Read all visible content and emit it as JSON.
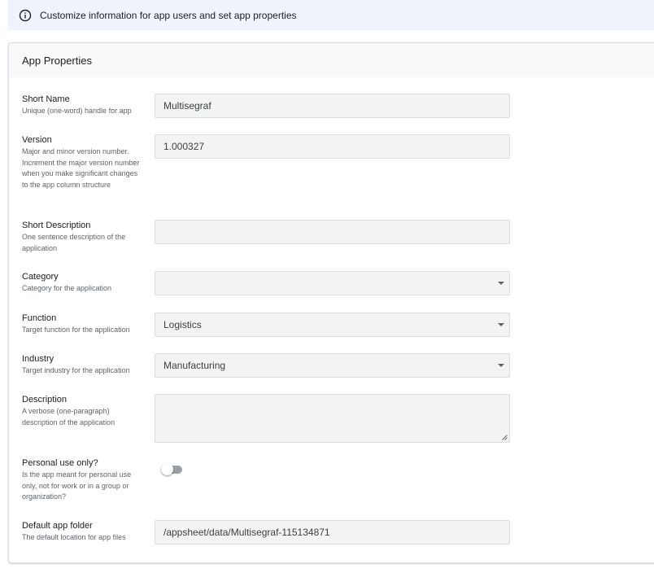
{
  "banner": {
    "icon": "info-icon",
    "text": "Customize information for app users and set app properties"
  },
  "card": {
    "title": "App Properties"
  },
  "fields": {
    "short_name": {
      "label": "Short Name",
      "description": "Unique (one-word) handle for app",
      "value": "Multisegraf"
    },
    "version": {
      "label": "Version",
      "description": "Major and minor version number. Increment the major version number when you make significant changes to the app column structure",
      "value": "1.000327"
    },
    "short_description": {
      "label": "Short Description",
      "description": "One sentence description of the application",
      "value": ""
    },
    "category": {
      "label": "Category",
      "description": "Category for the application",
      "value": ""
    },
    "function": {
      "label": "Function",
      "description": "Target function for the application",
      "value": "Logistics"
    },
    "industry": {
      "label": "Industry",
      "description": "Target industry for the application",
      "value": "Manufacturing"
    },
    "description": {
      "label": "Description",
      "description": "A verbose (one-paragraph) description of the application",
      "value": ""
    },
    "personal_use": {
      "label": "Personal use only?",
      "description": "Is the app meant for personal use only, not for work or in a group or organization?",
      "enabled": false
    },
    "default_folder": {
      "label": "Default app folder",
      "description": "The default location for app files",
      "value": "/appsheet/data/Multisegraf-115134871"
    }
  },
  "colors": {
    "banner_bg": "#eef3fc",
    "field_bg": "#f1f3f4",
    "toggle_off": "#9aa0a6"
  }
}
